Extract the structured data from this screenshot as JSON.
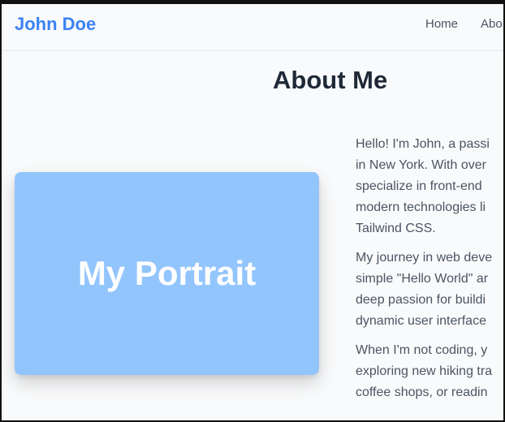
{
  "navbar": {
    "brand": "John Doe",
    "links": [
      "Home",
      "Abo"
    ]
  },
  "page": {
    "title": "About Me"
  },
  "portrait": {
    "label": "My Portrait"
  },
  "bio": {
    "paragraphs": [
      [
        "Hello! I'm John, a passi",
        "in New York. With over",
        "specialize in front-end",
        "modern technologies li",
        "Tailwind CSS."
      ],
      [
        "My journey in web deve",
        "simple \"Hello World\" ar",
        "deep passion for buildi",
        "dynamic user interface"
      ],
      [
        "When I'm not coding, y",
        "exploring new hiking tra",
        "coffee shops, or readin"
      ]
    ]
  },
  "colors": {
    "brand": "#3b82f6",
    "portrait_bg": "#93c5fd",
    "title": "#1f2937",
    "body_text": "#4b5563"
  }
}
